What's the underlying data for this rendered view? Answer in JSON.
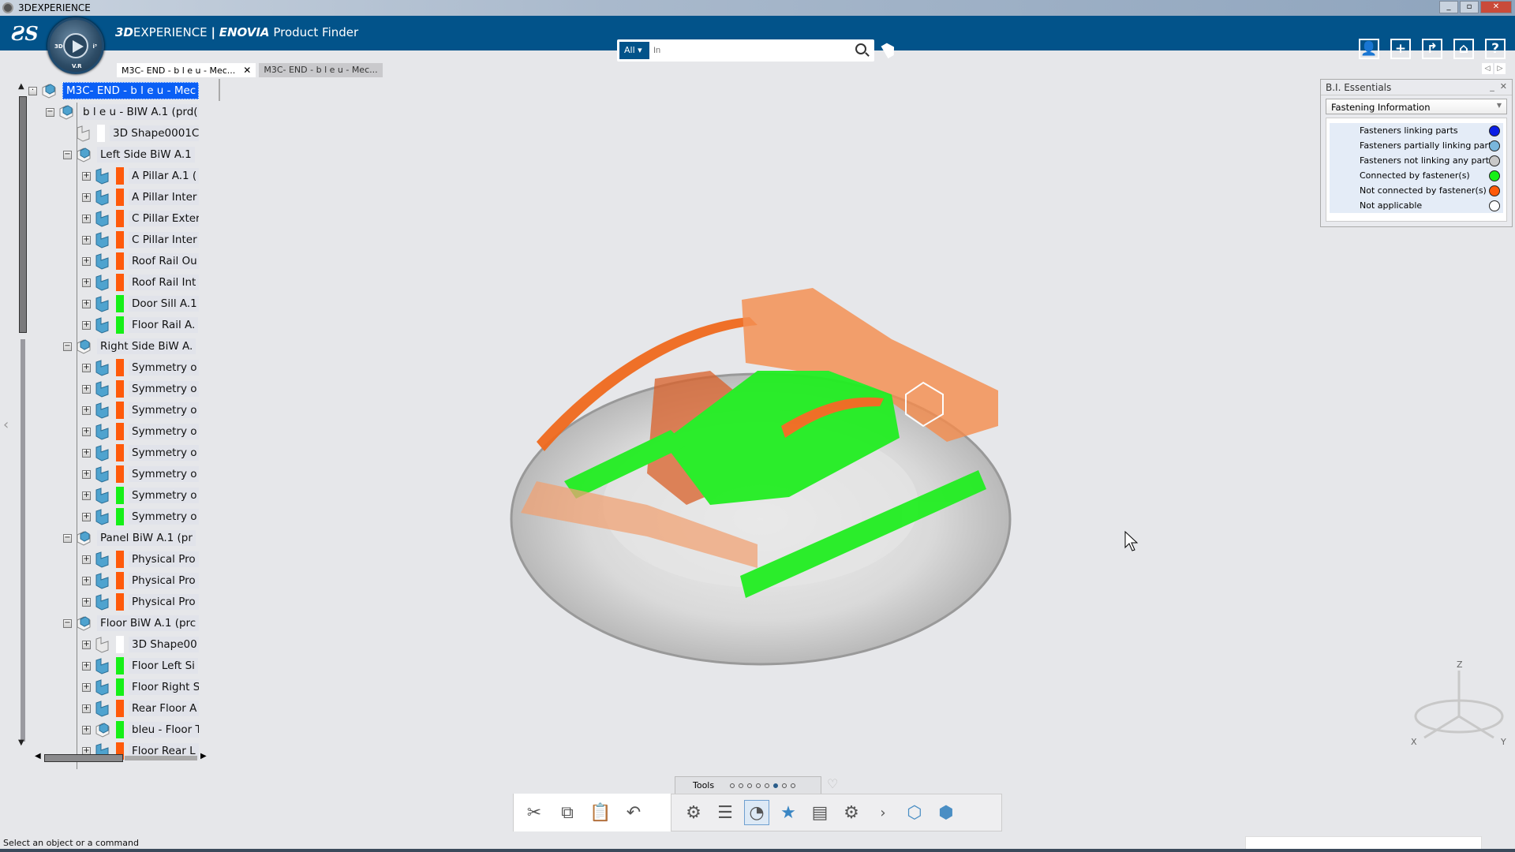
{
  "window": {
    "title": "3DEXPERIENCE"
  },
  "header": {
    "brand_bold": "3D",
    "brand_rest": "EXPERIENCE",
    "separator": "|",
    "app_bold": "ENOVIA",
    "app_rest": "Product Finder",
    "compass_labels": {
      "left": "3D",
      "right": "i³",
      "bottom": "V.R"
    },
    "search": {
      "scope": "All",
      "placeholder": "In",
      "value": ""
    },
    "icons": [
      "user-icon",
      "add-icon",
      "share-icon",
      "home-icon",
      "help-icon"
    ],
    "accent": "#02538a"
  },
  "tabs": [
    {
      "label": "M3C- END - b l e u - Mec...",
      "active": true,
      "close": "✕"
    },
    {
      "label": "M3C- END - b l e u - Mec...",
      "active": false
    }
  ],
  "tree": {
    "rows": [
      {
        "label": "M3C- END - b l e u - Mec",
        "level": 0,
        "kind": "product",
        "exp": "·",
        "selected": true
      },
      {
        "label": "b l e u - BIW A.1 (prd(",
        "level": 1,
        "kind": "product",
        "exp": "−"
      },
      {
        "label": "3D Shape0001C",
        "level": 2,
        "kind": "shape",
        "color": "#ffffff"
      },
      {
        "label": "Left Side BiW A.1",
        "level": 2,
        "kind": "product",
        "exp": "−"
      },
      {
        "label": "A Pillar A.1 (",
        "level": 3,
        "kind": "part",
        "exp": "+",
        "color": "#ff5a0a"
      },
      {
        "label": "A Pillar Inter",
        "level": 3,
        "kind": "part",
        "exp": "+",
        "color": "#ff5a0a"
      },
      {
        "label": "C Pillar Exter",
        "level": 3,
        "kind": "part",
        "exp": "+",
        "color": "#ff5a0a"
      },
      {
        "label": "C Pillar Inter",
        "level": 3,
        "kind": "part",
        "exp": "+",
        "color": "#ff5a0a"
      },
      {
        "label": "Roof Rail Ou",
        "level": 3,
        "kind": "part",
        "exp": "+",
        "color": "#ff5a0a"
      },
      {
        "label": "Roof Rail Int",
        "level": 3,
        "kind": "part",
        "exp": "+",
        "color": "#ff5a0a"
      },
      {
        "label": "Door Sill A.1",
        "level": 3,
        "kind": "part",
        "exp": "+",
        "color": "#16f016"
      },
      {
        "label": "Floor Rail A.",
        "level": 3,
        "kind": "part",
        "exp": "+",
        "color": "#16f016"
      },
      {
        "label": "Right Side BiW A.",
        "level": 2,
        "kind": "product",
        "exp": "−"
      },
      {
        "label": "Symmetry o",
        "level": 3,
        "kind": "part",
        "exp": "+",
        "color": "#ff5a0a"
      },
      {
        "label": "Symmetry o",
        "level": 3,
        "kind": "part",
        "exp": "+",
        "color": "#ff5a0a"
      },
      {
        "label": "Symmetry o",
        "level": 3,
        "kind": "part",
        "exp": "+",
        "color": "#ff5a0a"
      },
      {
        "label": "Symmetry o",
        "level": 3,
        "kind": "part",
        "exp": "+",
        "color": "#ff5a0a"
      },
      {
        "label": "Symmetry o",
        "level": 3,
        "kind": "part",
        "exp": "+",
        "color": "#ff5a0a"
      },
      {
        "label": "Symmetry o",
        "level": 3,
        "kind": "part",
        "exp": "+",
        "color": "#ff5a0a"
      },
      {
        "label": "Symmetry o",
        "level": 3,
        "kind": "part",
        "exp": "+",
        "color": "#16f016"
      },
      {
        "label": "Symmetry o",
        "level": 3,
        "kind": "part",
        "exp": "+",
        "color": "#16f016"
      },
      {
        "label": "Panel BiW A.1 (pr",
        "level": 2,
        "kind": "product",
        "exp": "−"
      },
      {
        "label": "Physical Pro",
        "level": 3,
        "kind": "part",
        "exp": "+",
        "color": "#ff5a0a"
      },
      {
        "label": "Physical Pro",
        "level": 3,
        "kind": "part",
        "exp": "+",
        "color": "#ff5a0a"
      },
      {
        "label": "Physical Pro",
        "level": 3,
        "kind": "part",
        "exp": "+",
        "color": "#ff5a0a"
      },
      {
        "label": "Floor BiW A.1 (prc",
        "level": 2,
        "kind": "product",
        "exp": "−"
      },
      {
        "label": "3D Shape00",
        "level": 3,
        "kind": "shape",
        "exp": "+",
        "color": "#ffffff"
      },
      {
        "label": "Floor Left Si",
        "level": 3,
        "kind": "part",
        "exp": "+",
        "color": "#16f016"
      },
      {
        "label": "Floor Right S",
        "level": 3,
        "kind": "part",
        "exp": "+",
        "color": "#16f016"
      },
      {
        "label": "Rear Floor A",
        "level": 3,
        "kind": "part",
        "exp": "+",
        "color": "#ff5a0a"
      },
      {
        "label": "bleu - Floor T",
        "level": 3,
        "kind": "product",
        "exp": "+",
        "color": "#16f016"
      },
      {
        "label": "Floor Rear L",
        "level": 3,
        "kind": "part",
        "exp": "+",
        "color": "#ff5a0a"
      }
    ]
  },
  "legend": {
    "title": "B.I. Essentials",
    "minimize": "_",
    "close": "✕",
    "dropdown": "Fastening Information",
    "items": [
      {
        "label": "Fasteners linking parts",
        "color": "#0a1ee6"
      },
      {
        "label": "Fasteners partially linking parts",
        "color": "#79b6dc"
      },
      {
        "label": "Fasteners not linking any parts",
        "color": "#c8c8c8"
      },
      {
        "label": "Connected by fastener(s)",
        "color": "#16f016"
      },
      {
        "label": "Not connected by fastener(s)",
        "color": "#ff5a0a"
      },
      {
        "label": "Not applicable",
        "color": "#ffffff"
      }
    ]
  },
  "compass3d": {
    "x": "X",
    "y": "Y",
    "z": "Z"
  },
  "toolbar": {
    "section": "Tools",
    "page_count": 8,
    "active_page": 6,
    "buttons": [
      "cut-icon",
      "copy-icon",
      "paste-icon",
      "undo-icon",
      "manage-icon",
      "select-table-icon",
      "bi-essentials-icon",
      "favorites-icon",
      "list-icon",
      "options-icon",
      "more-icon",
      "insert-icon",
      "product-icon"
    ]
  },
  "status": {
    "message": "Select an object or a command"
  }
}
